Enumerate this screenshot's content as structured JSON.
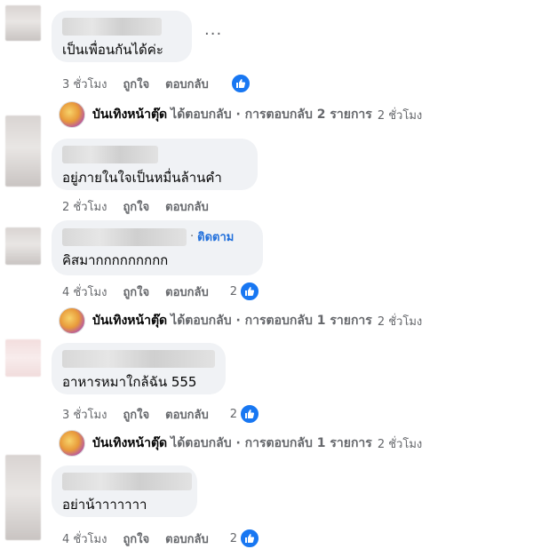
{
  "comments": [
    {
      "text": "เป็นเพื่อนกันได้ค่ะ",
      "time": "3 ชั่วโมง",
      "like": "ถูกใจ",
      "reply": "ตอบกลับ",
      "reaction_count": ""
    },
    {
      "text": "อยู่ภายในใจเป็นหมื่นล้านคำ",
      "time": "2 ชั่วโมง",
      "like": "ถูกใจ",
      "reply": "ตอบกลับ",
      "reaction_count": ""
    },
    {
      "follow_separator": "·",
      "follow_label": "ติดตาม",
      "text": "คิสมากกกกกกกกก",
      "time": "4 ชั่วโมง",
      "like": "ถูกใจ",
      "reply": "ตอบกลับ",
      "reaction_count": "2"
    },
    {
      "text": "อาหารหมาใกล้ฉัน 555",
      "time": "3 ชั่วโมง",
      "like": "ถูกใจ",
      "reply": "ตอบกลับ",
      "reaction_count": "2"
    },
    {
      "text": "อย่าน้าาาาาาา",
      "time": "4 ชั่วโมง",
      "like": "ถูกใจ",
      "reply": "ตอบกลับ",
      "reaction_count": "2"
    }
  ],
  "replies": [
    {
      "page_name": "บันเทิงหน้าตุ๊ด",
      "replied_label": "ได้ตอบกลับ · การตอบกลับ 2 รายการ",
      "time": "2 ชั่วโมง"
    },
    {
      "page_name": "บันเทิงหน้าตุ๊ด",
      "replied_label": "ได้ตอบกลับ · การตอบกลับ 1 รายการ",
      "time": "2 ชั่วโมง"
    },
    {
      "page_name": "บันเทิงหน้าตุ๊ด",
      "replied_label": "ได้ตอบกลับ · การตอบกลับ 1 รายการ",
      "time": "2 ชั่วโมง"
    }
  ],
  "more_options": "···",
  "colors": {
    "like_blue": "#1877f2",
    "bubble": "#f0f2f5",
    "meta_gray": "#65676b",
    "follow_blue": "#216fdb"
  }
}
